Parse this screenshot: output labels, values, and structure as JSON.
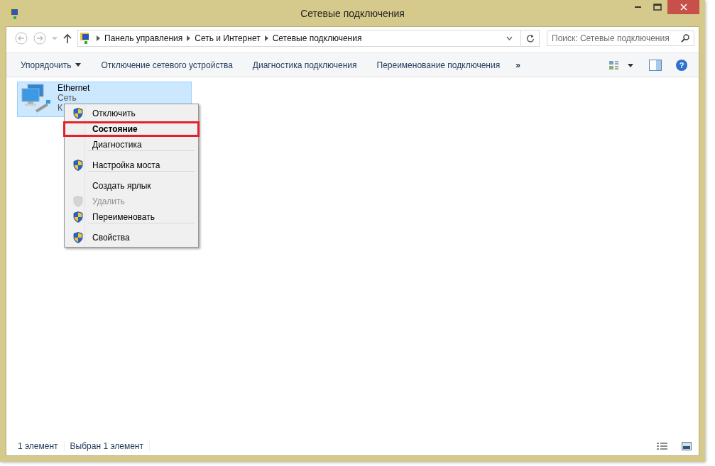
{
  "window": {
    "title": "Сетевые подключения"
  },
  "address": {
    "crumbs": [
      "Панель управления",
      "Сеть и Интернет",
      "Сетевые подключения"
    ]
  },
  "search": {
    "placeholder": "Поиск: Сетевые подключения"
  },
  "toolbar": {
    "items": [
      {
        "label": "Упорядочить",
        "dropdown": true
      },
      {
        "label": "Отключение сетевого устройства",
        "dropdown": false
      },
      {
        "label": "Диагностика подключения",
        "dropdown": false
      },
      {
        "label": "Переименование подключения",
        "dropdown": false
      }
    ],
    "more": "»",
    "help": "?"
  },
  "connection": {
    "name": "Ethernet",
    "line_2": "Сеть",
    "line_3": "К",
    "selected": true
  },
  "context_menu": {
    "items": [
      {
        "label": "Отключить",
        "shield": true,
        "disabled": false,
        "default": false,
        "highlighted": false,
        "separator_after": false
      },
      {
        "label": "Состояние",
        "shield": false,
        "disabled": false,
        "default": true,
        "highlighted": true,
        "separator_after": false
      },
      {
        "label": "Диагностика",
        "shield": false,
        "disabled": false,
        "default": false,
        "highlighted": false,
        "separator_after": true
      },
      {
        "label": "Настройка моста",
        "shield": true,
        "disabled": false,
        "default": false,
        "highlighted": false,
        "separator_after": true
      },
      {
        "label": "Создать ярлык",
        "shield": false,
        "disabled": false,
        "default": false,
        "highlighted": false,
        "separator_after": false
      },
      {
        "label": "Удалить",
        "shield": true,
        "disabled": true,
        "default": false,
        "highlighted": false,
        "separator_after": false
      },
      {
        "label": "Переименовать",
        "shield": true,
        "disabled": false,
        "default": false,
        "highlighted": false,
        "separator_after": true
      },
      {
        "label": "Свойства",
        "shield": true,
        "disabled": false,
        "default": false,
        "highlighted": false,
        "separator_after": false
      }
    ]
  },
  "status_bar": {
    "count": "1 элемент",
    "selection": "Выбран 1 элемент"
  }
}
